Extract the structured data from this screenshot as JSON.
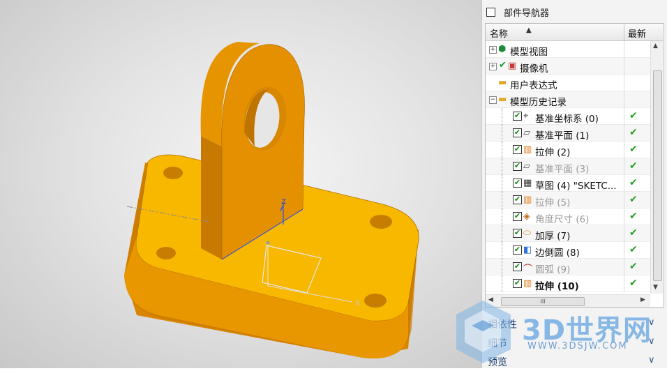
{
  "viewport": {
    "triad_labels": {
      "z": "Z",
      "x": "X"
    }
  },
  "navigator": {
    "title": "部件导航器",
    "columns": {
      "name": "名称",
      "latest": "最新"
    },
    "rows": [
      {
        "label": "模型视图",
        "icon": "model-views-icon",
        "dim": false,
        "bold": false,
        "latest": ""
      },
      {
        "label": "摄像机",
        "icon": "camera-icon",
        "dim": false,
        "bold": false,
        "latest": ""
      },
      {
        "label": "用户表达式",
        "icon": "folder-icon",
        "dim": false,
        "bold": false,
        "latest": ""
      },
      {
        "label": "模型历史记录",
        "icon": "folder-open-icon",
        "dim": false,
        "bold": false,
        "latest": ""
      },
      {
        "label": "基准坐标系 (0)",
        "icon": "datum-csys-icon",
        "dim": false,
        "bold": false,
        "latest": "✔"
      },
      {
        "label": "基准平面 (1)",
        "icon": "datum-plane-icon",
        "dim": false,
        "bold": false,
        "latest": "✔"
      },
      {
        "label": "拉伸 (2)",
        "icon": "extrude-icon",
        "dim": false,
        "bold": false,
        "latest": "✔"
      },
      {
        "label": "基准平面 (3)",
        "icon": "datum-plane-icon",
        "dim": true,
        "bold": false,
        "latest": "✔"
      },
      {
        "label": "草图 (4) \"SKETC...",
        "icon": "sketch-icon",
        "dim": false,
        "bold": false,
        "latest": "✔"
      },
      {
        "label": "拉伸 (5)",
        "icon": "extrude-icon",
        "dim": true,
        "bold": false,
        "latest": "✔"
      },
      {
        "label": "角度尺寸 (6)",
        "icon": "angle-dimension-icon",
        "dim": true,
        "bold": false,
        "latest": "✔"
      },
      {
        "label": "加厚 (7)",
        "icon": "thicken-icon",
        "dim": false,
        "bold": false,
        "latest": "✔"
      },
      {
        "label": "边倒圆 (8)",
        "icon": "edge-blend-icon",
        "dim": false,
        "bold": false,
        "latest": "✔"
      },
      {
        "label": "圆弧 (9)",
        "icon": "arc-icon",
        "dim": true,
        "bold": false,
        "latest": "✔"
      },
      {
        "label": "拉伸 (10)",
        "icon": "extrude-icon",
        "dim": false,
        "bold": true,
        "latest": "✔"
      }
    ],
    "sections": {
      "dependents": "相依性",
      "details": "细节",
      "preview": "预览"
    }
  },
  "watermark": {
    "brand": "3D世界网",
    "url": "WWW.3DSJW.COM"
  },
  "colors": {
    "part_yellow": "#f8b800",
    "part_orange": "#e08900",
    "check_green": "#22a022",
    "sketch_blue": "#3355dd"
  }
}
